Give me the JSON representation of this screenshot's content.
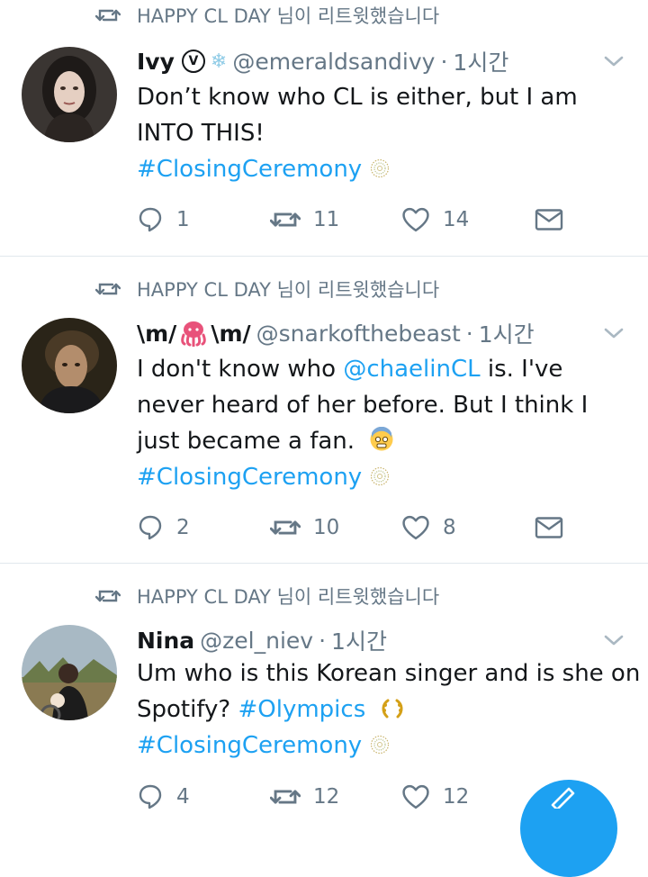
{
  "retweet_label": "HAPPY CL DAY 님이 리트윗했습니다",
  "tweets": [
    {
      "name": "Ivy",
      "badge": "V",
      "handle": "@emeraldsandivy",
      "time": "1시간",
      "lines": [
        "Don’t know who CL is either, but I am",
        "INTO THIS!"
      ],
      "hashtag": "#ClosingCeremony",
      "replies": "1",
      "retweets": "11",
      "likes": "14"
    },
    {
      "name_a": "\\m/",
      "name_b": "\\m/",
      "handle": "@snarkofthebeast",
      "time": "1시간",
      "line1_pre": "I don't know who ",
      "mention": "@chaelinCL",
      "line1_post": " is. I've",
      "line2": "never heard of her before. But I think I",
      "line3": "just became a fan.",
      "hashtag": "#ClosingCeremony",
      "replies": "2",
      "retweets": "10",
      "likes": "8"
    },
    {
      "name": "Nina",
      "handle": "@zel_niev",
      "time": "1시간",
      "line1": "Um who is this Korean singer and is she on",
      "line2_pre": "Spotify? ",
      "line2_tag": "#Olympics",
      "hashtag": "#ClosingCeremony",
      "replies": "4",
      "retweets": "12",
      "likes": "12"
    }
  ],
  "icons": {
    "retweet": "retweet-icon",
    "reply": "reply-icon",
    "like": "heart-icon",
    "dm": "envelope-icon",
    "more": "chevron-down-icon"
  },
  "colors": {
    "accent": "#1da1f2",
    "muted": "#657786",
    "text": "#14171a",
    "divider": "#e1e8ed"
  }
}
